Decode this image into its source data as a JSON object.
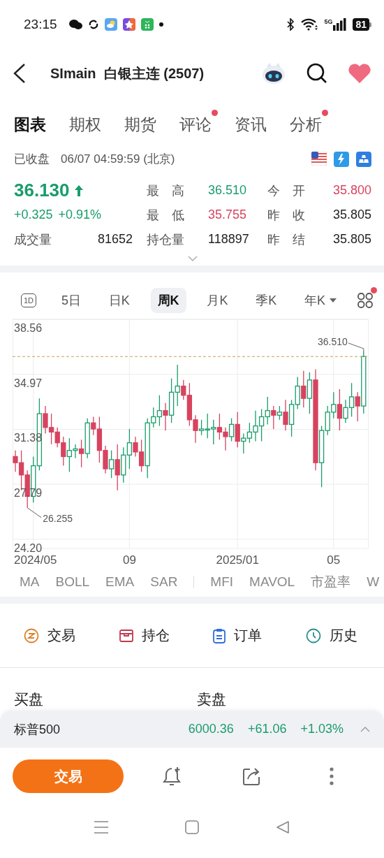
{
  "status_bar": {
    "time": "23:15",
    "network": "5G",
    "battery": "81"
  },
  "header": {
    "title": "SImain  白银主连 (2507)"
  },
  "tabs": [
    {
      "label": "图表",
      "selected": true,
      "badge": false
    },
    {
      "label": "期权",
      "selected": false,
      "badge": false
    },
    {
      "label": "期货",
      "selected": false,
      "badge": false
    },
    {
      "label": "评论",
      "selected": false,
      "badge": true
    },
    {
      "label": "资讯",
      "selected": false,
      "badge": false
    },
    {
      "label": "分析",
      "selected": false,
      "badge": true
    }
  ],
  "quote": {
    "status": "已收盘",
    "time": "06/07 04:59:59 (北京)",
    "price": "36.130",
    "change": "+0.325",
    "change_pct": "+0.91%",
    "stats": [
      {
        "label": "最 高",
        "value": "36.510",
        "color": "#1a9c6c"
      },
      {
        "label": "今 开",
        "value": "35.800",
        "color": "#d8435f"
      },
      {
        "label": "最 低",
        "value": "35.755",
        "color": "#d8435f"
      },
      {
        "label": "昨 收",
        "value": "35.805",
        "color": "#222222"
      },
      {
        "label": "成交量",
        "value": "81652",
        "color": "#222222"
      },
      {
        "label": "持仓量",
        "value": "118897",
        "color": "#222222"
      },
      {
        "label": "昨 结",
        "value": "35.805",
        "color": "#222222"
      }
    ]
  },
  "periods": [
    {
      "label": "1D",
      "kind": "icon",
      "selected": false
    },
    {
      "label": "5日",
      "kind": "text",
      "selected": false
    },
    {
      "label": "日K",
      "kind": "text",
      "selected": false
    },
    {
      "label": "周K",
      "kind": "text",
      "selected": true
    },
    {
      "label": "月K",
      "kind": "text",
      "selected": false
    },
    {
      "label": "季K",
      "kind": "text",
      "selected": false
    },
    {
      "label": "年K",
      "kind": "dropdown",
      "selected": false
    }
  ],
  "chart": {
    "chart_data": {
      "type": "candlestick",
      "ylim": [
        23.6,
        38.56
      ],
      "grid": true,
      "ref_lines": [
        {
          "axis": "y",
          "value": 36.13
        }
      ],
      "yticks": [
        {
          "value": 38.56,
          "label": "38.56"
        },
        {
          "value": 34.97,
          "label": "34.97"
        },
        {
          "value": 31.38,
          "label": "31.38"
        },
        {
          "value": 27.79,
          "label": "27.79"
        },
        {
          "value": 24.2,
          "label": "24.20"
        }
      ],
      "categories": [
        null,
        null,
        null,
        "2024/05",
        null,
        null,
        null,
        null,
        null,
        null,
        null,
        null,
        null,
        null,
        null,
        null,
        null,
        null,
        null,
        "09",
        null,
        null,
        null,
        null,
        null,
        null,
        null,
        null,
        null,
        null,
        null,
        null,
        null,
        null,
        null,
        null,
        null,
        "2025/01",
        null,
        null,
        null,
        null,
        null,
        null,
        null,
        null,
        null,
        null,
        null,
        null,
        null,
        null,
        null,
        "05",
        null,
        null,
        null,
        null,
        null
      ],
      "ohlc": [
        [
          29.6,
          30.0,
          28.6,
          29.2
        ],
        [
          29.2,
          30.0,
          27.4,
          28.4
        ],
        [
          28.4,
          28.7,
          26.255,
          27.0
        ],
        [
          27.0,
          29.6,
          26.6,
          29.0
        ],
        [
          29.0,
          33.4,
          28.7,
          32.4
        ],
        [
          32.4,
          32.9,
          31.1,
          31.5
        ],
        [
          31.5,
          32.4,
          30.4,
          31.2
        ],
        [
          31.2,
          31.5,
          30.2,
          30.5
        ],
        [
          30.5,
          30.9,
          29.0,
          29.6
        ],
        [
          29.6,
          30.8,
          28.6,
          30.0
        ],
        [
          30.0,
          30.4,
          29.5,
          30.1
        ],
        [
          30.1,
          30.7,
          28.9,
          29.8
        ],
        [
          29.8,
          32.1,
          29.5,
          31.8
        ],
        [
          31.8,
          32.2,
          31.0,
          31.4
        ],
        [
          31.4,
          32.2,
          29.2,
          30.0
        ],
        [
          30.0,
          30.3,
          28.5,
          28.8
        ],
        [
          28.8,
          30.0,
          28.2,
          29.4
        ],
        [
          29.4,
          30.4,
          27.4,
          28.4
        ],
        [
          28.4,
          30.2,
          27.9,
          29.7
        ],
        [
          29.7,
          31.4,
          28.8,
          30.5
        ],
        [
          30.5,
          30.9,
          29.6,
          29.9
        ],
        [
          29.9,
          30.7,
          28.6,
          29.0
        ],
        [
          29.0,
          32.1,
          28.2,
          31.8
        ],
        [
          31.8,
          32.8,
          31.5,
          32.2
        ],
        [
          32.2,
          33.6,
          31.6,
          32.6
        ],
        [
          32.6,
          33.1,
          31.3,
          32.3
        ],
        [
          32.3,
          34.7,
          31.8,
          33.8
        ],
        [
          33.8,
          35.6,
          32.9,
          34.2
        ],
        [
          34.2,
          34.6,
          33.3,
          33.6
        ],
        [
          33.6,
          34.4,
          31.6,
          32.0
        ],
        [
          32.0,
          32.3,
          30.5,
          31.3
        ],
        [
          31.3,
          32.0,
          31.0,
          31.4
        ],
        [
          31.4,
          32.4,
          30.8,
          31.4
        ],
        [
          31.4,
          32.0,
          30.4,
          31.5
        ],
        [
          31.5,
          32.4,
          30.7,
          31.2
        ],
        [
          31.2,
          31.5,
          30.0,
          30.9
        ],
        [
          30.9,
          32.1,
          30.6,
          31.7
        ],
        [
          31.7,
          32.5,
          30.2,
          30.6
        ],
        [
          30.6,
          31.1,
          29.8,
          30.8
        ],
        [
          30.8,
          31.8,
          30.5,
          31.2
        ],
        [
          31.2,
          32.6,
          30.6,
          31.6
        ],
        [
          31.6,
          32.7,
          30.6,
          32.2
        ],
        [
          32.2,
          33.5,
          31.7,
          32.6
        ],
        [
          32.6,
          32.9,
          31.4,
          32.3
        ],
        [
          32.3,
          32.9,
          32.0,
          32.5
        ],
        [
          32.5,
          33.3,
          31.3,
          31.7
        ],
        [
          31.7,
          33.3,
          30.9,
          33.0
        ],
        [
          33.0,
          34.8,
          32.7,
          34.2
        ],
        [
          34.2,
          35.2,
          32.8,
          33.4
        ],
        [
          33.4,
          35.1,
          32.4,
          34.6
        ],
        [
          34.6,
          35.3,
          28.7,
          29.2
        ],
        [
          29.2,
          31.6,
          27.6,
          31.3
        ],
        [
          31.3,
          32.9,
          31.0,
          32.5
        ],
        [
          32.5,
          33.8,
          32.1,
          33.0
        ],
        [
          33.0,
          34.0,
          31.3,
          32.1
        ],
        [
          32.1,
          33.3,
          31.8,
          32.8
        ],
        [
          32.8,
          34.4,
          32.2,
          33.5
        ],
        [
          33.5,
          33.8,
          31.9,
          32.9
        ],
        [
          32.9,
          36.51,
          32.4,
          36.13
        ]
      ],
      "annotations": [
        "36.510",
        "26.255"
      ]
    }
  },
  "indicator_groups": [
    [
      "MA",
      "BOLL",
      "EMA",
      "SAR"
    ],
    [
      "MFI",
      "MAVOL",
      "市盈率",
      "W"
    ]
  ],
  "actions": [
    {
      "label": "交易",
      "kind": "trade"
    },
    {
      "label": "持仓",
      "kind": "position"
    },
    {
      "label": "订单",
      "kind": "orders"
    },
    {
      "label": "历史",
      "kind": "history"
    }
  ],
  "book": {
    "bid_title": "买盘",
    "ask_title": "卖盘"
  },
  "ticker": {
    "name": "标普500",
    "value": "6000.36",
    "change": "+61.06",
    "change_pct": "+1.03%"
  },
  "bottom_bar": {
    "trade_button": "交易"
  }
}
